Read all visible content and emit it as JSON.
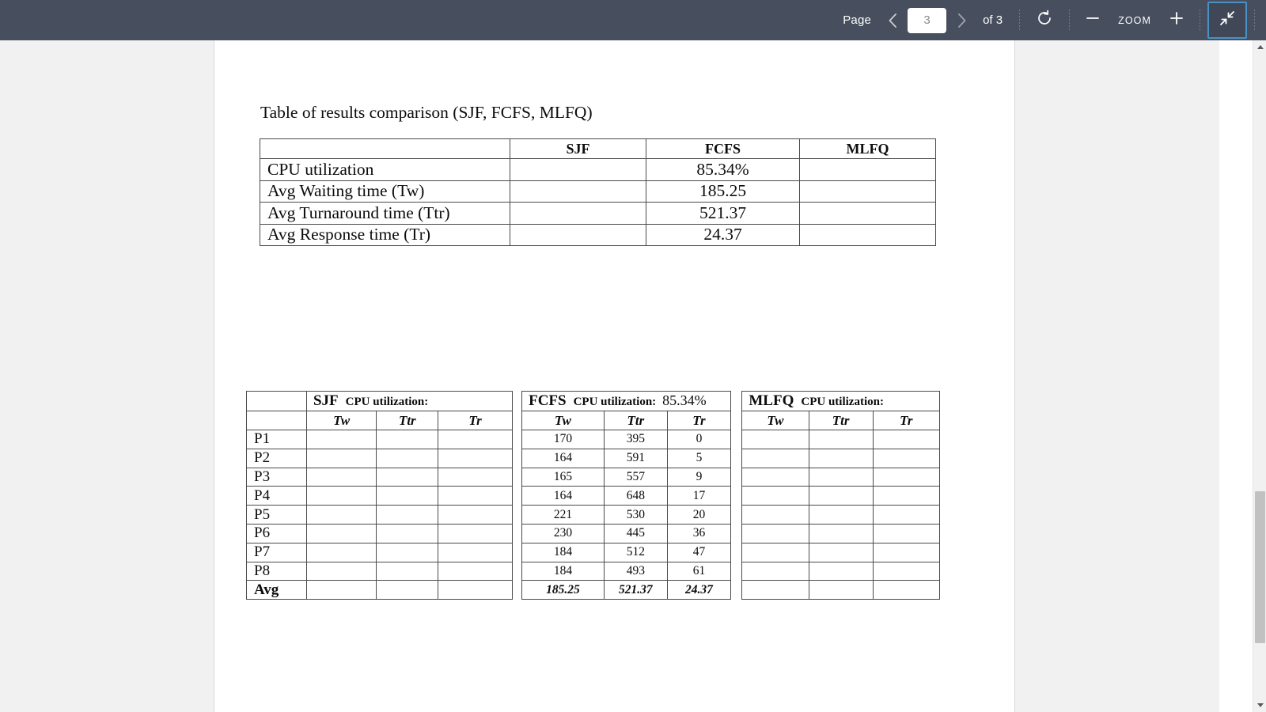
{
  "toolbar": {
    "page_label": "Page",
    "prev_icon": "chevron-left-icon",
    "page_value": "3",
    "next_icon": "chevron-right-icon",
    "of_label": "of 3",
    "rotate_icon": "rotate-icon",
    "zoom_out_icon": "minus-icon",
    "zoom_label": "ZOOM",
    "zoom_in_icon": "plus-icon",
    "fit_icon": "exit-fullscreen-icon",
    "accent_color": "#4a90c4",
    "background_color": "#474f5e"
  },
  "document": {
    "caption": "Table of results comparison (SJF, FCFS, MLFQ)",
    "summary_table": {
      "columns": [
        "",
        "SJF",
        "FCFS",
        "MLFQ"
      ],
      "rows": [
        {
          "label": "CPU utilization",
          "sjf": "",
          "fcfs": "85.34%",
          "mlfq": ""
        },
        {
          "label": "Avg Waiting time (Tw)",
          "sjf": "",
          "fcfs": "185.25",
          "mlfq": ""
        },
        {
          "label": "Avg Turnaround time (Ttr)",
          "sjf": "",
          "fcfs": "521.37",
          "mlfq": ""
        },
        {
          "label": "Avg Response time (Tr)",
          "sjf": "",
          "fcfs": "24.37",
          "mlfq": ""
        }
      ]
    },
    "detail_table": {
      "groups": [
        {
          "name": "SJF",
          "cpu_label": "CPU utilization:",
          "cpu_value": ""
        },
        {
          "name": "FCFS",
          "cpu_label": "CPU utilization:",
          "cpu_value": "85.34%"
        },
        {
          "name": "MLFQ",
          "cpu_label": "CPU utilization:",
          "cpu_value": ""
        }
      ],
      "subheaders": [
        "Tw",
        "Ttr",
        "Tr"
      ],
      "rows": [
        {
          "pid": "P1",
          "sjf": [
            "",
            "",
            ""
          ],
          "fcfs": [
            "170",
            "395",
            "0"
          ],
          "mlfq": [
            "",
            "",
            ""
          ]
        },
        {
          "pid": "P2",
          "sjf": [
            "",
            "",
            ""
          ],
          "fcfs": [
            "164",
            "591",
            "5"
          ],
          "mlfq": [
            "",
            "",
            ""
          ]
        },
        {
          "pid": "P3",
          "sjf": [
            "",
            "",
            ""
          ],
          "fcfs": [
            "165",
            "557",
            "9"
          ],
          "mlfq": [
            "",
            "",
            ""
          ]
        },
        {
          "pid": "P4",
          "sjf": [
            "",
            "",
            ""
          ],
          "fcfs": [
            "164",
            "648",
            "17"
          ],
          "mlfq": [
            "",
            "",
            ""
          ]
        },
        {
          "pid": "P5",
          "sjf": [
            "",
            "",
            ""
          ],
          "fcfs": [
            "221",
            "530",
            "20"
          ],
          "mlfq": [
            "",
            "",
            ""
          ]
        },
        {
          "pid": "P6",
          "sjf": [
            "",
            "",
            ""
          ],
          "fcfs": [
            "230",
            "445",
            "36"
          ],
          "mlfq": [
            "",
            "",
            ""
          ]
        },
        {
          "pid": "P7",
          "sjf": [
            "",
            "",
            ""
          ],
          "fcfs": [
            "184",
            "512",
            "47"
          ],
          "mlfq": [
            "",
            "",
            ""
          ]
        },
        {
          "pid": "P8",
          "sjf": [
            "",
            "",
            ""
          ],
          "fcfs": [
            "184",
            "493",
            "61"
          ],
          "mlfq": [
            "",
            "",
            ""
          ]
        }
      ],
      "average_row": {
        "pid": "Avg",
        "sjf": [
          "",
          "",
          ""
        ],
        "fcfs": [
          "185.25",
          "521.37",
          "24.37"
        ],
        "mlfq": [
          "",
          "",
          ""
        ]
      }
    }
  },
  "scrollbar": {
    "up_icon": "scroll-up-arrow-icon",
    "down_icon": "scroll-down-arrow-icon"
  }
}
